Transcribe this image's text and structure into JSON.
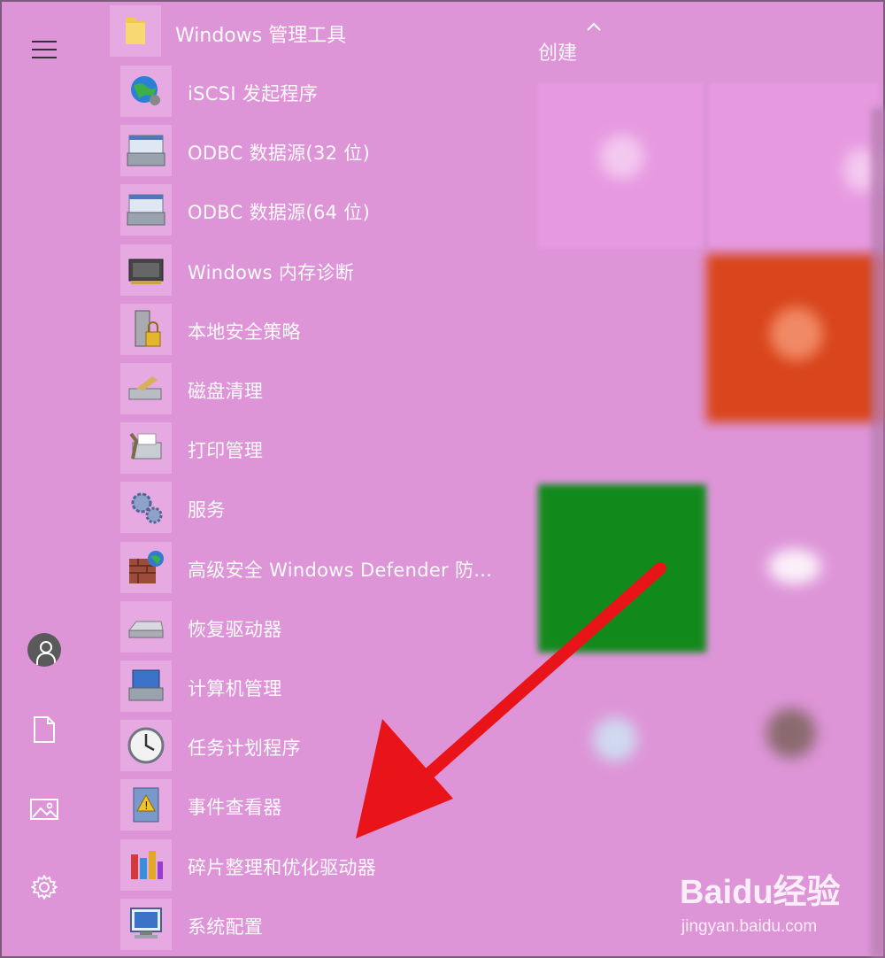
{
  "folder": {
    "label": "Windows 管理工具",
    "icon": "folder-icon",
    "expanded": true
  },
  "tiles_group": {
    "title": "创建"
  },
  "apps": [
    {
      "label": "iSCSI 发起程序",
      "icon": "iscsi-globe-icon"
    },
    {
      "label": "ODBC 数据源(32 位)",
      "icon": "odbc-32-icon"
    },
    {
      "label": "ODBC 数据源(64 位)",
      "icon": "odbc-64-icon"
    },
    {
      "label": "Windows 内存诊断",
      "icon": "memory-chip-icon"
    },
    {
      "label": "本地安全策略",
      "icon": "security-policy-icon"
    },
    {
      "label": "磁盘清理",
      "icon": "disk-cleanup-icon"
    },
    {
      "label": "打印管理",
      "icon": "print-management-icon"
    },
    {
      "label": "服务",
      "icon": "services-gears-icon"
    },
    {
      "label": "高级安全 Windows Defender 防...",
      "icon": "firewall-icon"
    },
    {
      "label": "恢复驱动器",
      "icon": "recovery-drive-icon"
    },
    {
      "label": "计算机管理",
      "icon": "computer-management-icon"
    },
    {
      "label": "任务计划程序",
      "icon": "task-scheduler-clock-icon"
    },
    {
      "label": "事件查看器",
      "icon": "event-viewer-icon"
    },
    {
      "label": "碎片整理和优化驱动器",
      "icon": "defrag-icon"
    },
    {
      "label": "系统配置",
      "icon": "system-config-icon"
    }
  ],
  "watermark": {
    "logo": "Baidu经验",
    "url": "jingyan.baidu.com"
  },
  "colors": {
    "background": "#de95d8",
    "tile_orange": "#d9451c",
    "tile_green": "#118a1b",
    "arrow": "#e8141a"
  }
}
